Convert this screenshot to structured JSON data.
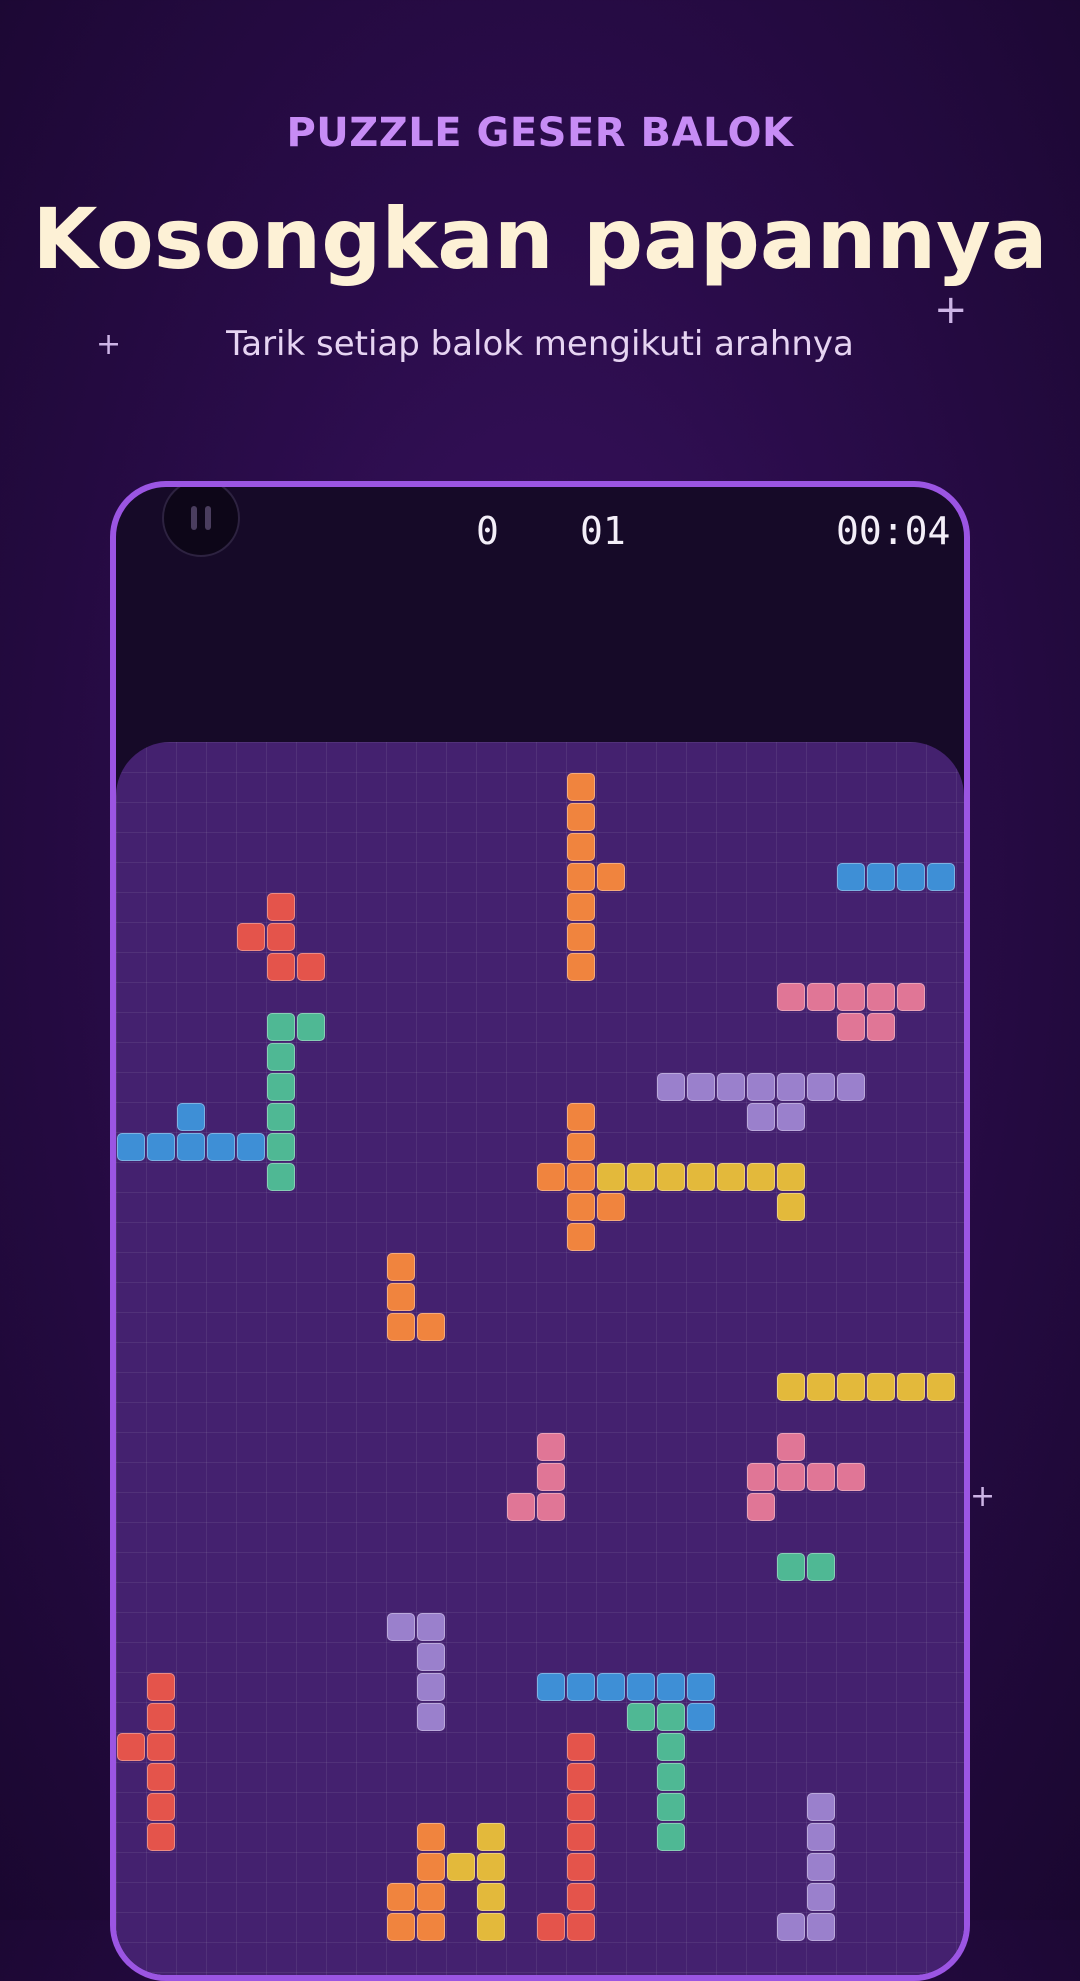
{
  "header": {
    "kicker": "PUZZLE GESER BALOK",
    "title": "Kosongkan papannya",
    "subtitle": "Tarik setiap balok mengikuti arahnya"
  },
  "hud": {
    "score": "0",
    "level": "01",
    "timer": "00:04"
  },
  "colors": {
    "orange": "#f0843e",
    "red": "#e4544b",
    "blue": "#3e8fd6",
    "pink": "#e07696",
    "green": "#4fb894",
    "purple": "#9a80cc",
    "yellow": "#e3b93b",
    "accent": "#9b55e3"
  },
  "board": {
    "pieces": [
      {
        "name": "orange-vertical-piece",
        "color": "orange",
        "cells": [
          [
            15,
            1
          ],
          [
            15,
            2
          ],
          [
            15,
            3
          ],
          [
            15,
            4
          ],
          [
            16,
            4
          ],
          [
            15,
            5
          ],
          [
            15,
            6
          ],
          [
            15,
            7
          ]
        ]
      },
      {
        "name": "blue-top-right-piece",
        "color": "blue",
        "cells": [
          [
            24,
            4
          ],
          [
            25,
            4
          ],
          [
            26,
            4
          ],
          [
            27,
            4
          ]
        ]
      },
      {
        "name": "red-s-piece",
        "color": "red",
        "cells": [
          [
            5,
            5
          ],
          [
            4,
            6
          ],
          [
            5,
            6
          ],
          [
            5,
            7
          ],
          [
            6,
            7
          ]
        ]
      },
      {
        "name": "pink-t-piece",
        "color": "pink",
        "cells": [
          [
            22,
            8
          ],
          [
            23,
            8
          ],
          [
            24,
            8
          ],
          [
            25,
            8
          ],
          [
            26,
            8
          ],
          [
            24,
            9
          ],
          [
            25,
            9
          ]
        ]
      },
      {
        "name": "green-j-piece",
        "color": "green",
        "cells": [
          [
            5,
            9
          ],
          [
            6,
            9
          ],
          [
            5,
            10
          ],
          [
            5,
            11
          ],
          [
            5,
            12
          ],
          [
            5,
            13
          ],
          [
            5,
            14
          ]
        ]
      },
      {
        "name": "purple-long-piece",
        "color": "purple",
        "cells": [
          [
            18,
            11
          ],
          [
            19,
            11
          ],
          [
            20,
            11
          ],
          [
            21,
            11
          ],
          [
            22,
            11
          ],
          [
            23,
            11
          ],
          [
            24,
            11
          ],
          [
            21,
            12
          ],
          [
            22,
            12
          ]
        ]
      },
      {
        "name": "blue-left-piece",
        "color": "blue",
        "cells": [
          [
            2,
            12
          ],
          [
            0,
            13
          ],
          [
            1,
            13
          ],
          [
            2,
            13
          ],
          [
            3,
            13
          ],
          [
            4,
            13
          ]
        ]
      },
      {
        "name": "orange-cross-piece",
        "color": "orange",
        "cells": [
          [
            15,
            12
          ],
          [
            15,
            13
          ],
          [
            14,
            14
          ],
          [
            15,
            14
          ],
          [
            15,
            15
          ],
          [
            16,
            15
          ],
          [
            15,
            16
          ]
        ]
      },
      {
        "name": "yellow-bar-piece",
        "color": "yellow",
        "cells": [
          [
            16,
            14
          ],
          [
            17,
            14
          ],
          [
            18,
            14
          ],
          [
            19,
            14
          ],
          [
            20,
            14
          ],
          [
            21,
            14
          ],
          [
            22,
            14
          ],
          [
            22,
            15
          ]
        ]
      },
      {
        "name": "orange-l-piece",
        "color": "orange",
        "cells": [
          [
            9,
            17
          ],
          [
            9,
            18
          ],
          [
            9,
            19
          ],
          [
            10,
            19
          ]
        ]
      },
      {
        "name": "yellow-right-piece",
        "color": "yellow",
        "cells": [
          [
            22,
            21
          ],
          [
            23,
            21
          ],
          [
            24,
            21
          ],
          [
            25,
            21
          ],
          [
            26,
            21
          ],
          [
            27,
            21
          ]
        ]
      },
      {
        "name": "pink-j-piece",
        "color": "pink",
        "cells": [
          [
            14,
            23
          ],
          [
            14,
            24
          ],
          [
            13,
            25
          ],
          [
            14,
            25
          ]
        ]
      },
      {
        "name": "pink-cross-piece",
        "color": "pink",
        "cells": [
          [
            22,
            23
          ],
          [
            21,
            24
          ],
          [
            22,
            24
          ],
          [
            23,
            24
          ],
          [
            24,
            24
          ],
          [
            21,
            25
          ]
        ]
      },
      {
        "name": "green-small-piece",
        "color": "green",
        "cells": [
          [
            22,
            27
          ],
          [
            23,
            27
          ]
        ]
      },
      {
        "name": "purple-small-piece",
        "color": "purple",
        "cells": [
          [
            9,
            29
          ],
          [
            10,
            29
          ],
          [
            10,
            30
          ],
          [
            10,
            31
          ],
          [
            10,
            32
          ]
        ]
      },
      {
        "name": "blue-bottom-piece",
        "color": "blue",
        "cells": [
          [
            14,
            31
          ],
          [
            15,
            31
          ],
          [
            16,
            31
          ],
          [
            17,
            31
          ],
          [
            18,
            31
          ],
          [
            19,
            31
          ],
          [
            19,
            32
          ]
        ]
      },
      {
        "name": "green-bottom-piece",
        "color": "green",
        "cells": [
          [
            17,
            32
          ],
          [
            18,
            32
          ],
          [
            18,
            33
          ],
          [
            18,
            34
          ],
          [
            18,
            35
          ],
          [
            18,
            36
          ]
        ]
      },
      {
        "name": "red-left-piece",
        "color": "red",
        "cells": [
          [
            1,
            31
          ],
          [
            1,
            32
          ],
          [
            0,
            33
          ],
          [
            1,
            33
          ],
          [
            1,
            34
          ],
          [
            1,
            35
          ],
          [
            1,
            36
          ]
        ]
      },
      {
        "name": "red-bottom-piece",
        "color": "red",
        "cells": [
          [
            15,
            33
          ],
          [
            15,
            34
          ],
          [
            15,
            35
          ],
          [
            15,
            36
          ],
          [
            15,
            37
          ],
          [
            15,
            38
          ],
          [
            14,
            39
          ],
          [
            15,
            39
          ]
        ]
      },
      {
        "name": "purple-bottom-piece",
        "color": "purple",
        "cells": [
          [
            23,
            35
          ],
          [
            23,
            36
          ],
          [
            23,
            37
          ],
          [
            23,
            38
          ],
          [
            22,
            39
          ],
          [
            23,
            39
          ]
        ]
      },
      {
        "name": "orange-bottom-piece",
        "color": "orange",
        "cells": [
          [
            10,
            36
          ],
          [
            10,
            37
          ],
          [
            9,
            38
          ],
          [
            10,
            38
          ],
          [
            9,
            39
          ],
          [
            10,
            39
          ]
        ]
      },
      {
        "name": "yellow-bottom-piece",
        "color": "yellow",
        "cells": [
          [
            12,
            36
          ],
          [
            11,
            37
          ],
          [
            12,
            37
          ],
          [
            12,
            38
          ],
          [
            12,
            39
          ]
        ]
      }
    ]
  }
}
